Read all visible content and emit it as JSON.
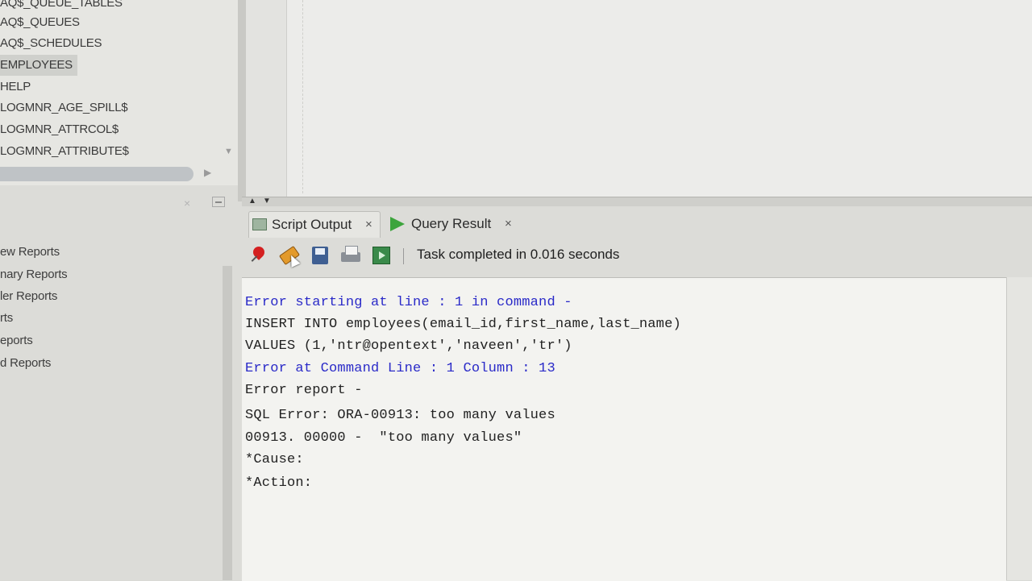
{
  "tables_tree": {
    "items": [
      {
        "label": "AQ$_QUEUE_TABLES",
        "selected": false
      },
      {
        "label": "AQ$_QUEUES",
        "selected": false
      },
      {
        "label": "AQ$_SCHEDULES",
        "selected": false
      },
      {
        "label": "EMPLOYEES",
        "selected": true
      },
      {
        "label": "HELP",
        "selected": false
      },
      {
        "label": "LOGMNR_AGE_SPILL$",
        "selected": false
      },
      {
        "label": "LOGMNR_ATTRCOL$",
        "selected": false
      },
      {
        "label": "LOGMNR_ATTRIBUTE$",
        "selected": false
      }
    ]
  },
  "reports_panel": {
    "close_glyph": "×",
    "items": [
      {
        "label": "ew Reports"
      },
      {
        "label": "nary Reports"
      },
      {
        "label": "ler Reports"
      },
      {
        "label": "rts"
      },
      {
        "label": "eports"
      },
      {
        "label": "d Reports"
      }
    ]
  },
  "results": {
    "tabs": [
      {
        "label": "Script Output",
        "icon": "monitor-icon",
        "close": "×",
        "active": true
      },
      {
        "label": "Query Result",
        "icon": "play-icon",
        "close": "×",
        "active": false
      }
    ],
    "toolbar": {
      "buttons": [
        {
          "icon": "pin-icon"
        },
        {
          "icon": "eraser-icon"
        },
        {
          "icon": "save-icon"
        },
        {
          "icon": "print-icon"
        },
        {
          "icon": "export-icon"
        }
      ],
      "status": "Task completed in 0.016 seconds"
    },
    "output_lines": [
      {
        "text": "Error starting at line : 1 in command -",
        "style": "blue"
      },
      {
        "text": "INSERT INTO employees(email_id,first_name,last_name)",
        "style": "dark"
      },
      {
        "text": "VALUES (1,'ntr@opentext','naveen','tr')",
        "style": "dark"
      },
      {
        "text": "Error at Command Line : 1 Column : 13",
        "style": "blue"
      },
      {
        "text": "Error report -",
        "style": "dark"
      },
      {
        "text": "SQL Error: ORA-00913: too many values",
        "style": "dark"
      },
      {
        "text": "00913. 00000 -  \"too many values\"",
        "style": "dark"
      },
      {
        "text": "*Cause:",
        "style": "dark"
      },
      {
        "text": "*Action:",
        "style": "dark"
      }
    ]
  },
  "colors": {
    "error_blue": "#2a2ac8",
    "text_dark": "#222222",
    "pin_red": "#d42020",
    "query_green": "#3ca43c"
  }
}
